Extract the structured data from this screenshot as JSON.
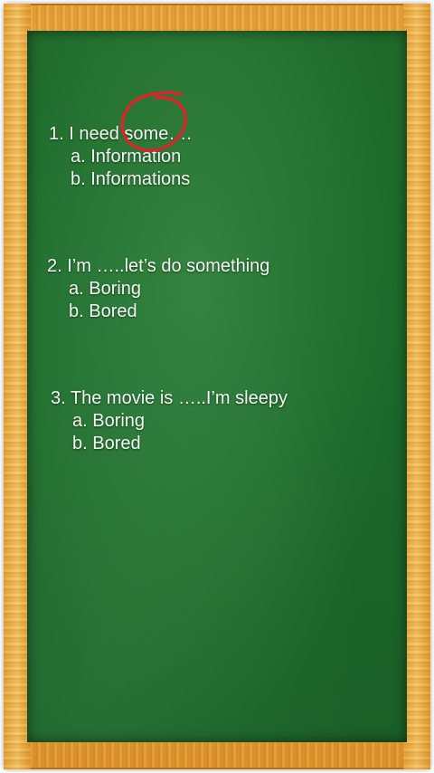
{
  "quiz": {
    "questions": [
      {
        "number": "1.",
        "prompt": "I need some….",
        "options": [
          "a. Information",
          "b. Informations"
        ]
      },
      {
        "number": "2.",
        "prompt": "I’m …..let’s do something",
        "options": [
          "a. Boring",
          "b. Bored"
        ]
      },
      {
        "number": "3.",
        "prompt": "The movie is …..I’m sleepy",
        "options": [
          "a. Boring",
          "b. Bored"
        ]
      }
    ]
  },
  "colors": {
    "board": "#1c6a2b",
    "frame": "#f0b64d",
    "chalk": "#f4f6f4",
    "annotation": "#e5202a"
  }
}
